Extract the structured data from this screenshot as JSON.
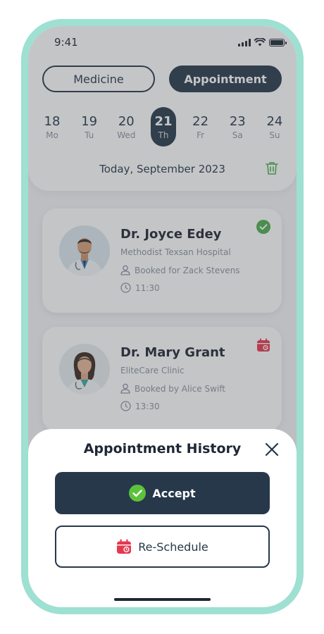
{
  "status_bar": {
    "time": "9:41"
  },
  "tabs": [
    {
      "label": "Medicine",
      "active": false
    },
    {
      "label": "Appointment",
      "active": true
    }
  ],
  "calendar": {
    "days": [
      {
        "num": "18",
        "wd": "Mo"
      },
      {
        "num": "19",
        "wd": "Tu"
      },
      {
        "num": "20",
        "wd": "Wed"
      },
      {
        "num": "21",
        "wd": "Th"
      },
      {
        "num": "22",
        "wd": "Fr"
      },
      {
        "num": "23",
        "wd": "Sa"
      },
      {
        "num": "24",
        "wd": "Su"
      }
    ],
    "selected_index": 3,
    "today_label": "Today, September 2023"
  },
  "appointments": [
    {
      "doctor": "Dr. Joyce Edey",
      "hospital": "Methodist Texsan Hospital",
      "booked": "Booked for Zack Stevens",
      "time": "11:30",
      "status_icon": "check-circle-icon"
    },
    {
      "doctor": "Dr. Mary Grant",
      "hospital": "EliteCare Clinic",
      "booked": "Booked by Alice Swift",
      "time": "13:30",
      "status_icon": "calendar-reschedule-icon"
    }
  ],
  "sheet": {
    "title": "Appointment History",
    "accept_label": "Accept",
    "reschedule_label": "Re-Schedule"
  },
  "colors": {
    "navy": "#27384b",
    "green": "#4caf50",
    "red": "#e5384f",
    "teal_frame": "#9ee0d2"
  }
}
